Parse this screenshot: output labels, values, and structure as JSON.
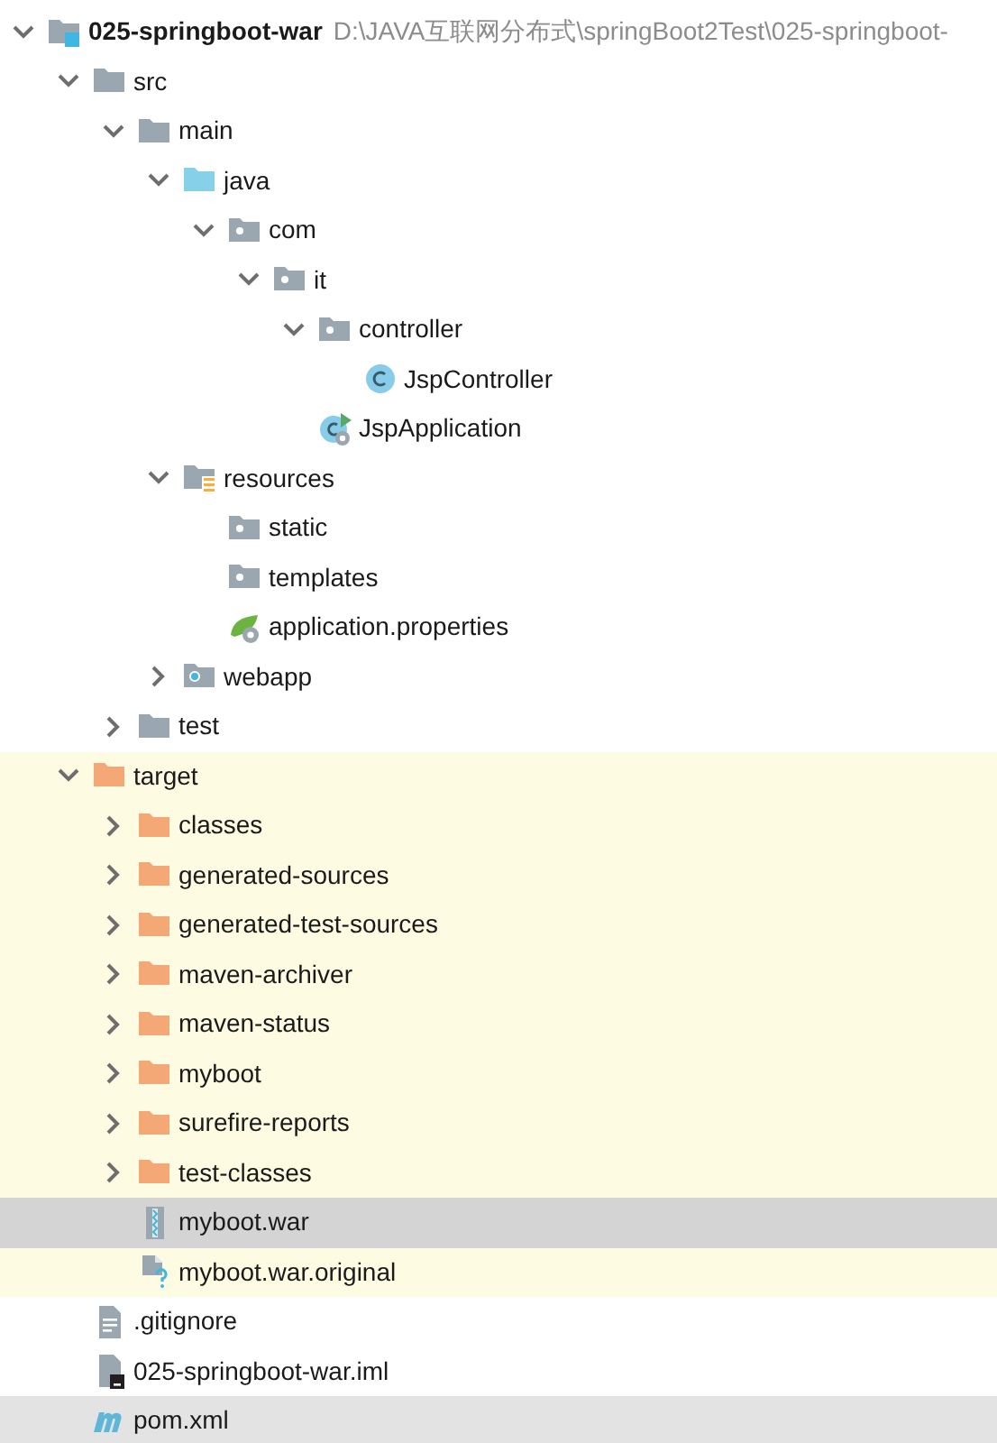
{
  "project_tree": {
    "label": "025-springboot-war",
    "path": "D:\\JAVA互联网分布式\\springBoot2Test\\025-springboot-",
    "kind": "module",
    "expanded": true,
    "children": [
      {
        "label": "src",
        "kind": "folder",
        "expanded": true,
        "children": [
          {
            "label": "main",
            "kind": "folder",
            "expanded": true,
            "children": [
              {
                "label": "java",
                "kind": "source-folder",
                "expanded": true,
                "children": [
                  {
                    "label": "com",
                    "kind": "package",
                    "expanded": true,
                    "children": [
                      {
                        "label": "it",
                        "kind": "package",
                        "expanded": true,
                        "children": [
                          {
                            "label": "controller",
                            "kind": "package",
                            "expanded": true,
                            "children": [
                              {
                                "label": "JspController",
                                "kind": "class"
                              }
                            ]
                          },
                          {
                            "label": "JspApplication",
                            "kind": "boot-class"
                          }
                        ]
                      }
                    ]
                  }
                ]
              },
              {
                "label": "resources",
                "kind": "resources",
                "expanded": true,
                "children": [
                  {
                    "label": "static",
                    "kind": "package"
                  },
                  {
                    "label": "templates",
                    "kind": "package"
                  },
                  {
                    "label": "application.properties",
                    "kind": "properties"
                  }
                ]
              },
              {
                "label": "webapp",
                "kind": "web-folder",
                "expanded": false
              }
            ]
          },
          {
            "label": "test",
            "kind": "folder",
            "expanded": false
          }
        ]
      },
      {
        "label": "target",
        "kind": "excluded-folder",
        "expanded": true,
        "excluded": true,
        "children": [
          {
            "label": "classes",
            "kind": "excluded-folder",
            "expanded": false
          },
          {
            "label": "generated-sources",
            "kind": "excluded-folder",
            "expanded": false
          },
          {
            "label": "generated-test-sources",
            "kind": "excluded-folder",
            "expanded": false
          },
          {
            "label": "maven-archiver",
            "kind": "excluded-folder",
            "expanded": false
          },
          {
            "label": "maven-status",
            "kind": "excluded-folder",
            "expanded": false
          },
          {
            "label": "myboot",
            "kind": "excluded-folder",
            "expanded": false
          },
          {
            "label": "surefire-reports",
            "kind": "excluded-folder",
            "expanded": false
          },
          {
            "label": "test-classes",
            "kind": "excluded-folder",
            "expanded": false
          },
          {
            "label": "myboot.war",
            "kind": "archive",
            "selected": true
          },
          {
            "label": "myboot.war.original",
            "kind": "unknown-file",
            "selected": false
          }
        ]
      },
      {
        "label": ".gitignore",
        "kind": "text-file",
        "selected": false
      },
      {
        "label": "025-springboot-war.iml",
        "kind": "iml-file",
        "selected": false
      },
      {
        "label": "pom.xml",
        "kind": "maven-file",
        "selected": false,
        "hovered": true
      }
    ]
  }
}
